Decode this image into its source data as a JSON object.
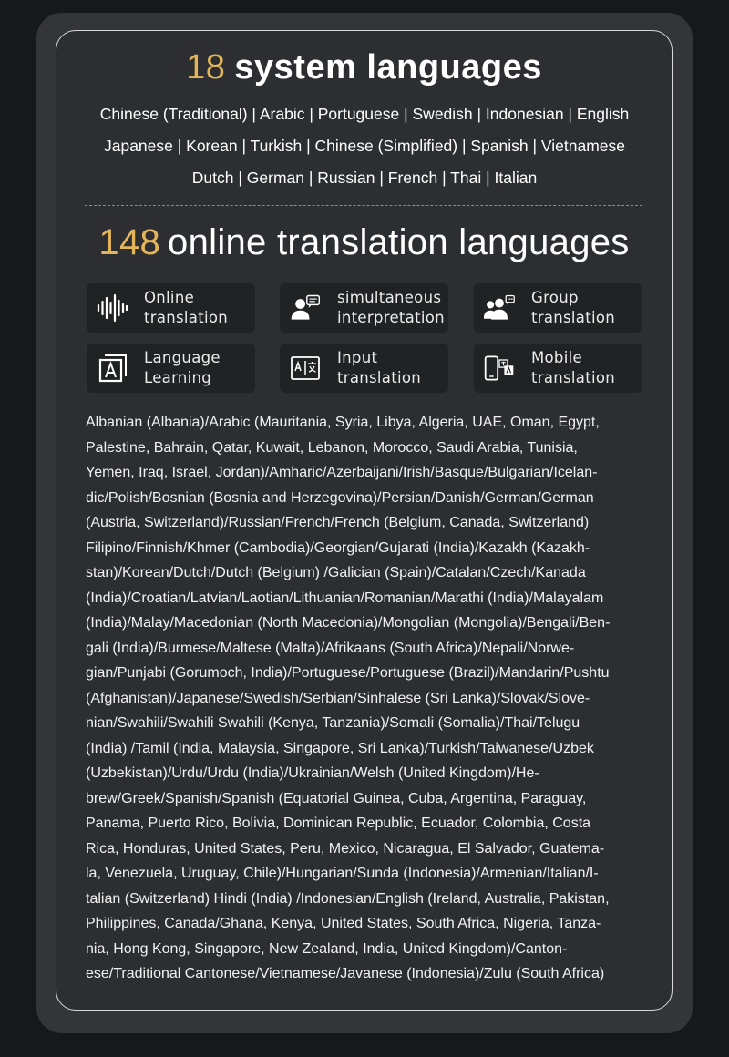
{
  "header": {
    "system_count": "18",
    "system_title": "system languages",
    "system_lines": [
      "Chinese (Traditional) | Arabic | Portuguese | Swedish | Indonesian | English",
      "Japanese | Korean | Turkish | Chinese (Simplified) | Spanish | Vietnamese",
      "Dutch | German | Russian | French | Thai | Italian"
    ],
    "online_count": "148",
    "online_title": "online translation languages"
  },
  "features": [
    {
      "icon": "soundwave-icon",
      "line1": "Online",
      "line2": "translation"
    },
    {
      "icon": "interpreter-icon",
      "line1": "simultaneous",
      "line2": "interpretation"
    },
    {
      "icon": "group-icon",
      "line1": "Group",
      "line2": "translation"
    },
    {
      "icon": "language-book-icon",
      "line1": "Language",
      "line2": "Learning"
    },
    {
      "icon": "input-translate-icon",
      "line1": "Input",
      "line2": "translation"
    },
    {
      "icon": "mobile-translate-icon",
      "line1": "Mobile",
      "line2": "translation"
    }
  ],
  "online_languages_lines": [
    "Albanian (Albania)/Arabic (Mauritania, Syria, Libya, Algeria, UAE, Oman, Egypt,",
    "Palestine, Bahrain, Qatar, Kuwait, Lebanon, Morocco, Saudi Arabia, Tunisia,",
    "Yemen, Iraq, Israel, Jordan)/Amharic/Azerbaijani/Irish/Basque/Bulgarian/Icelan-",
    "dic/Polish/Bosnian (Bosnia and Herzegovina)/Persian/Danish/German/German",
    "(Austria, Switzerland)/Russian/French/French (Belgium, Canada, Switzerland)",
    "Filipino/Finnish/Khmer (Cambodia)/Georgian/Gujarati (India)/Kazakh (Kazakh-",
    "stan)/Korean/Dutch/Dutch (Belgium) /Galician (Spain)/Catalan/Czech/Kanada",
    "(India)/Croatian/Latvian/Laotian/Lithuanian/Romanian/Marathi (India)/Malayalam",
    "(India)/Malay/Macedonian (North Macedonia)/Mongolian (Mongolia)/Bengali/Ben-",
    "gali (India)/Burmese/Maltese (Malta)/Afrikaans (South Africa)/Nepali/Norwe-",
    "gian/Punjabi (Gorumoch, India)/Portuguese/Portuguese (Brazil)/Mandarin/Pushtu",
    "(Afghanistan)/Japanese/Swedish/Serbian/Sinhalese (Sri Lanka)/Slovak/Slove-",
    "nian/Swahili/Swahili Swahili (Kenya, Tanzania)/Somali (Somalia)/Thai/Telugu",
    "(India) /Tamil (India, Malaysia, Singapore, Sri Lanka)/Turkish/Taiwanese/Uzbek",
    "(Uzbekistan)/Urdu/Urdu (India)/Ukrainian/Welsh (United Kingdom)/He-",
    "brew/Greek/Spanish/Spanish (Equatorial Guinea, Cuba, Argentina, Paraguay,",
    "Panama, Puerto Rico, Bolivia, Dominican Republic, Ecuador, Colombia, Costa",
    "Rica, Honduras, United States, Peru, Mexico, Nicaragua, El Salvador, Guatema-",
    "la, Venezuela, Uruguay, Chile)/Hungarian/Sunda (Indonesia)/Armenian/Italian/I-",
    "talian (Switzerland) Hindi (India) /Indonesian/English (Ireland, Australia, Pakistan,",
    "Philippines, Canada/Ghana, Kenya, United States, South Africa, Nigeria, Tanza-",
    "nia, Hong Kong, Singapore, New Zealand, India, United Kingdom)/Canton-",
    "ese/Traditional Cantonese/Vietnamese/Javanese (Indonesia)/Zulu (South Africa)"
  ],
  "colors": {
    "accent": "#e2b55a",
    "background": "#16191b",
    "card": "#333538",
    "feature_tile": "#202224"
  }
}
